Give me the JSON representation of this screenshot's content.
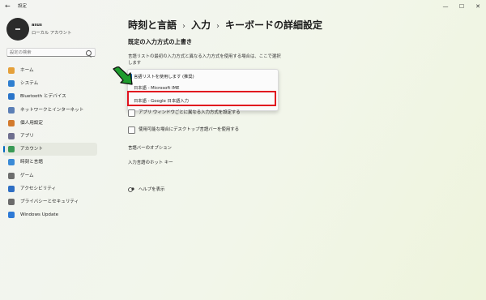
{
  "window": {
    "app_title": "設定",
    "back_glyph": "←",
    "min_glyph": "—",
    "max_glyph": "☐",
    "close_glyph": "✕"
  },
  "profile": {
    "name": "asus",
    "account_type": "ローカル アカウント"
  },
  "search": {
    "placeholder": "設定の検索"
  },
  "nav": {
    "active_index": 6,
    "items": [
      {
        "label": "ホーム",
        "icon": "home-icon",
        "color": "#e5a03a"
      },
      {
        "label": "システム",
        "icon": "system-icon",
        "color": "#2f7fd0"
      },
      {
        "label": "Bluetooth とデバイス",
        "icon": "bluetooth-icon",
        "color": "#2a74c9"
      },
      {
        "label": "ネットワークとインターネット",
        "icon": "network-icon",
        "color": "#5c7fb6"
      },
      {
        "label": "個人用設定",
        "icon": "brush-icon",
        "color": "#d37a2d"
      },
      {
        "label": "アプリ",
        "icon": "apps-icon",
        "color": "#6f6f8f"
      },
      {
        "label": "アカウント",
        "icon": "account-icon",
        "color": "#3a9a56"
      },
      {
        "label": "時刻と言語",
        "icon": "time-language-icon",
        "color": "#3a8ad6"
      },
      {
        "label": "ゲーム",
        "icon": "gaming-icon",
        "color": "#6d6d6d"
      },
      {
        "label": "アクセシビリティ",
        "icon": "accessibility-icon",
        "color": "#2f6fc4"
      },
      {
        "label": "プライバシーとセキュリティ",
        "icon": "shield-icon",
        "color": "#6b6b6b"
      },
      {
        "label": "Windows Update",
        "icon": "update-icon",
        "color": "#2d7ad6"
      }
    ]
  },
  "main": {
    "breadcrumb": [
      "時刻と言語",
      "入力",
      "キーボードの詳細設定"
    ],
    "breadcrumb_sep": "›",
    "section_title": "既定の入力方式の上書き",
    "description": "言語リストの最初の入力方式と異なる入力方式を使用する場合は、ここで選択します",
    "dropdown": {
      "options": [
        "言語リストを使用します (推奨)",
        "日本語 - Microsoft IME",
        "日本語 - Google 日本語入力"
      ],
      "selected_index": 0,
      "highlighted_index": 2
    },
    "checkboxes": [
      {
        "label": "アプリ ウィンドウごとに異なる入力方式を設定する",
        "checked": false
      },
      {
        "label": "使用可能な場合にデスクトップ言語バーを使用する",
        "checked": false
      }
    ],
    "links": [
      "言語バーのオプション",
      "入力言語のホット キー"
    ],
    "help_label": "ヘルプを表示"
  },
  "colors": {
    "accent": "#0067c0",
    "highlight": "#e1131f",
    "arrow_green": "#1f9c2e"
  }
}
